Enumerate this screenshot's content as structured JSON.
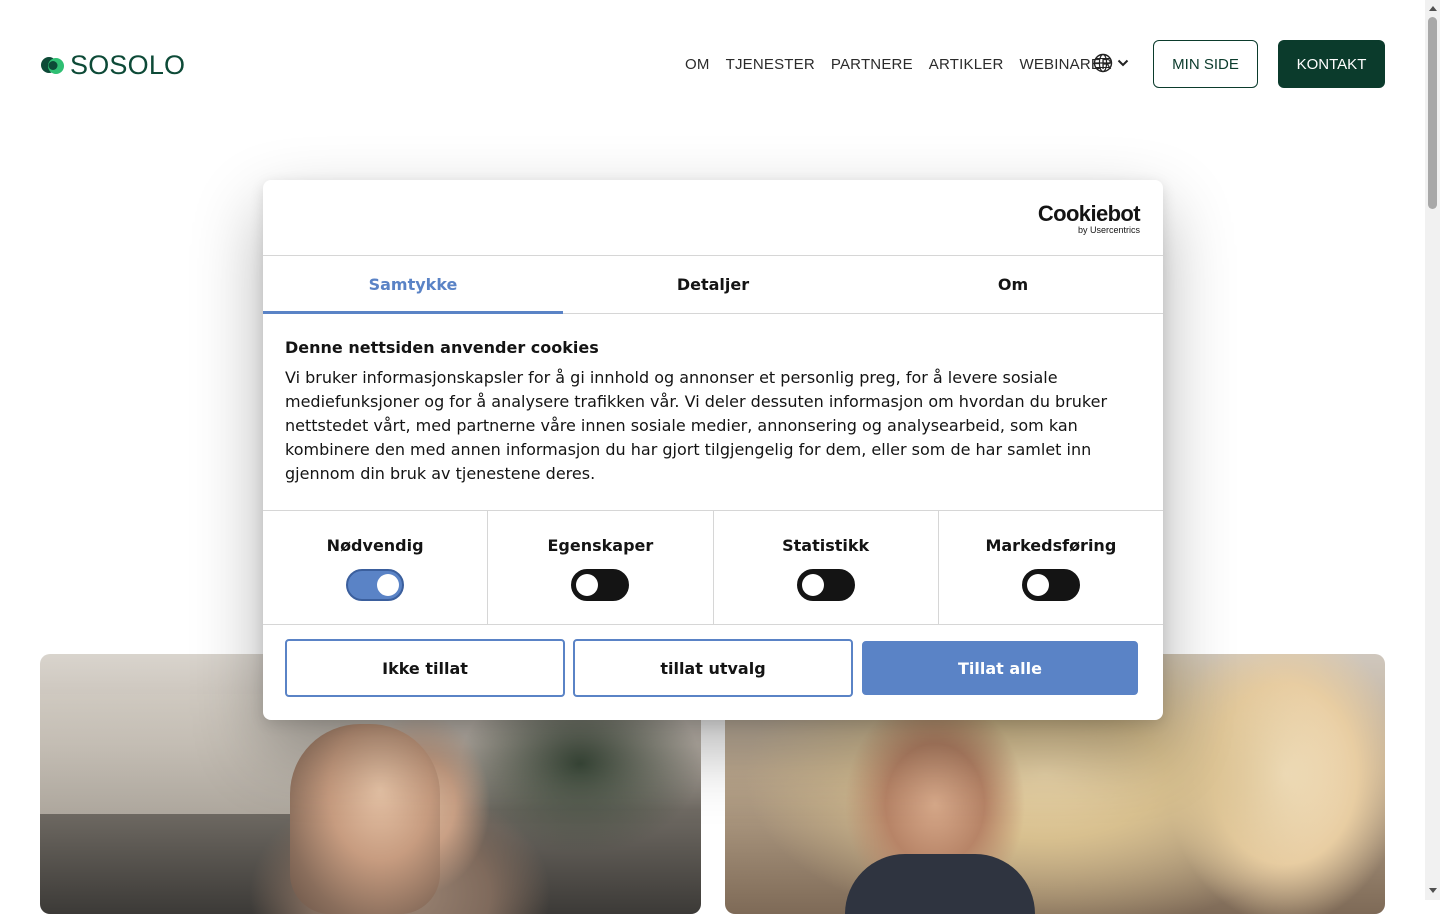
{
  "brand": {
    "name": "SOSOLO"
  },
  "nav": {
    "items": [
      "OM",
      "TJENESTER",
      "PARTNERE",
      "ARTIKLER",
      "WEBINARER"
    ],
    "language_icon": "globe-icon",
    "min_side": "MIN SIDE",
    "kontakt": "KONTAKT"
  },
  "colors": {
    "brand_green": "#0b3b2c",
    "cookie_accent": "#5a83c6"
  },
  "cookie": {
    "provider": "Cookiebot",
    "provider_sub": "by Usercentrics",
    "tabs": [
      "Samtykke",
      "Detaljer",
      "Om"
    ],
    "active_tab": "Samtykke",
    "title": "Denne nettsiden anvender cookies",
    "text": "Vi bruker informasjonskapsler for å gi innhold og annonser et personlig preg, for å levere sosiale mediefunksjoner og for å analysere trafikken vår. Vi deler dessuten informasjon om hvordan du bruker nettstedet vårt, med partnerne våre innen sosiale medier, annonsering og analysearbeid, som kan kombinere den med annen informasjon du har gjort tilgjengelig for dem, eller som de har samlet inn gjennom din bruk av tjenestene deres.",
    "categories": [
      {
        "label": "Nødvendig",
        "enabled": true
      },
      {
        "label": "Egenskaper",
        "enabled": false
      },
      {
        "label": "Statistikk",
        "enabled": false
      },
      {
        "label": "Markedsføring",
        "enabled": false
      }
    ],
    "buttons": {
      "deny": "Ikke tillat",
      "allow_selection": "tillat utvalg",
      "allow_all": "Tillat alle"
    }
  }
}
